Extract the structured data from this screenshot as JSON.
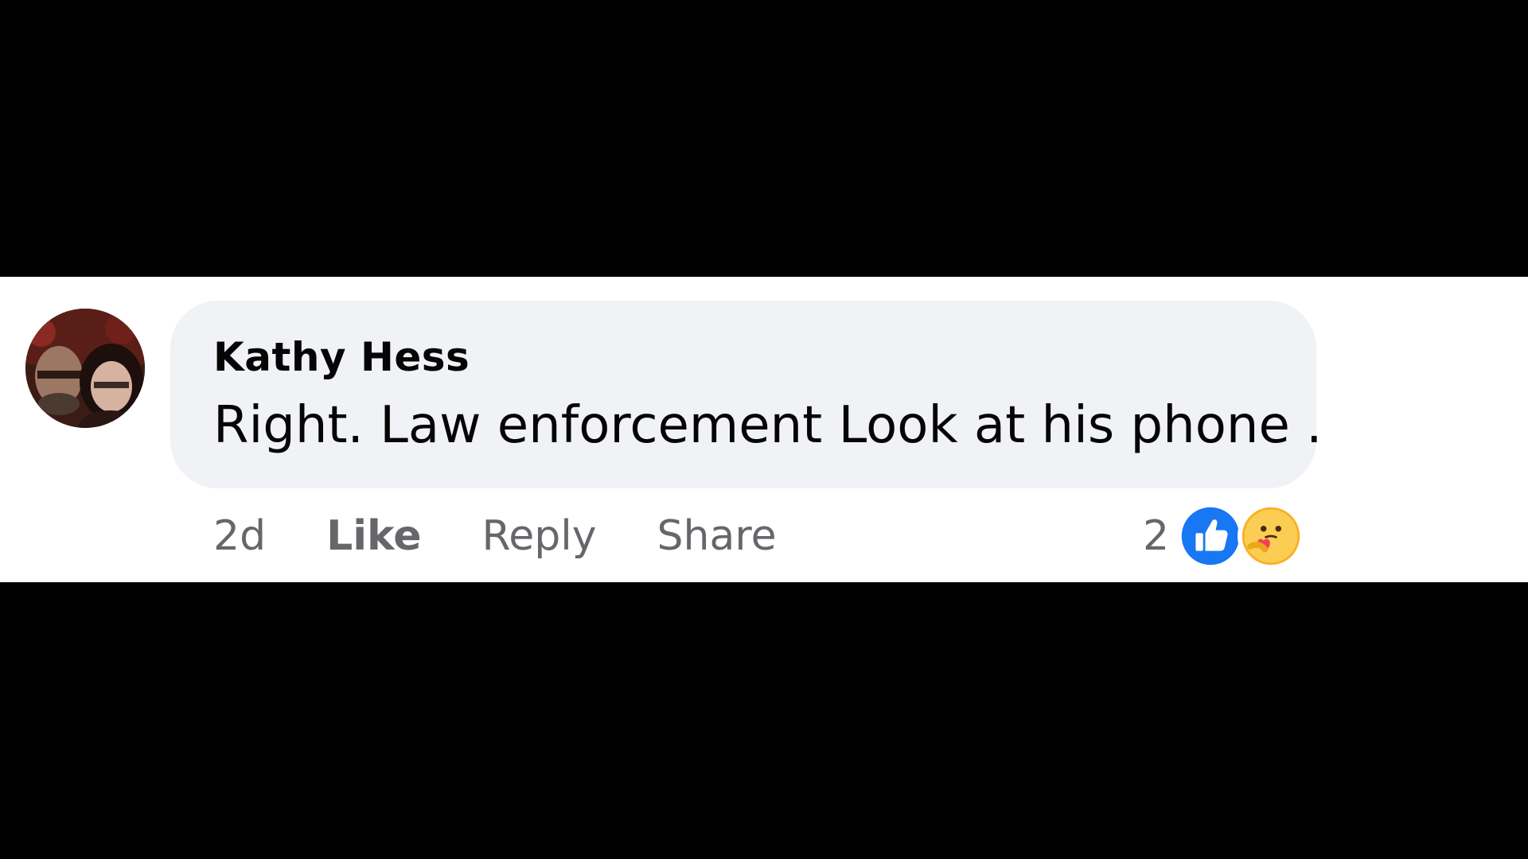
{
  "comment": {
    "author": "Kathy Hess",
    "text": "Right. Law enforcement Look at his phone .",
    "timestamp": "2d",
    "actions": {
      "like": "Like",
      "reply": "Reply",
      "share": "Share"
    },
    "reactions": {
      "count": "2",
      "types": [
        "like-icon",
        "care-icon"
      ],
      "like_color": "#1877f2",
      "care_color": "#f7b125"
    }
  },
  "colors": {
    "bubble": "#f0f2f5",
    "text": "#050505",
    "secondary_text": "#65676b",
    "background": "#000000"
  }
}
